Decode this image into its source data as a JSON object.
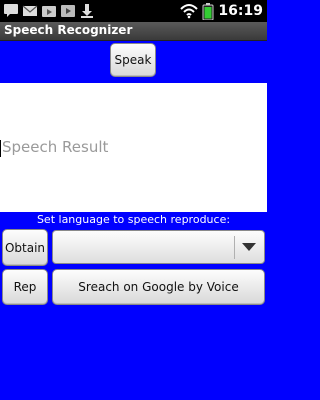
{
  "status_bar": {
    "time": "16:19",
    "icons_left": [
      "chat-icon",
      "mail-icon",
      "play-store-icon",
      "media-icon",
      "download-icon"
    ],
    "icons_right": [
      "wifi-icon",
      "battery-icon"
    ]
  },
  "app": {
    "title": "Speech Recognizer"
  },
  "main": {
    "speak_label": "Speak",
    "result_placeholder": "Speech Result",
    "language_label": "Set language to speech reproduce:",
    "obtain_label": "Obtain",
    "language_selected": "",
    "rep_label": "Rep",
    "google_label": "Sreach on Google by Voice"
  },
  "colors": {
    "background": "#0000ff",
    "status_bar": "#000000",
    "battery": "#33cc33",
    "result_area": "#ffffff"
  }
}
